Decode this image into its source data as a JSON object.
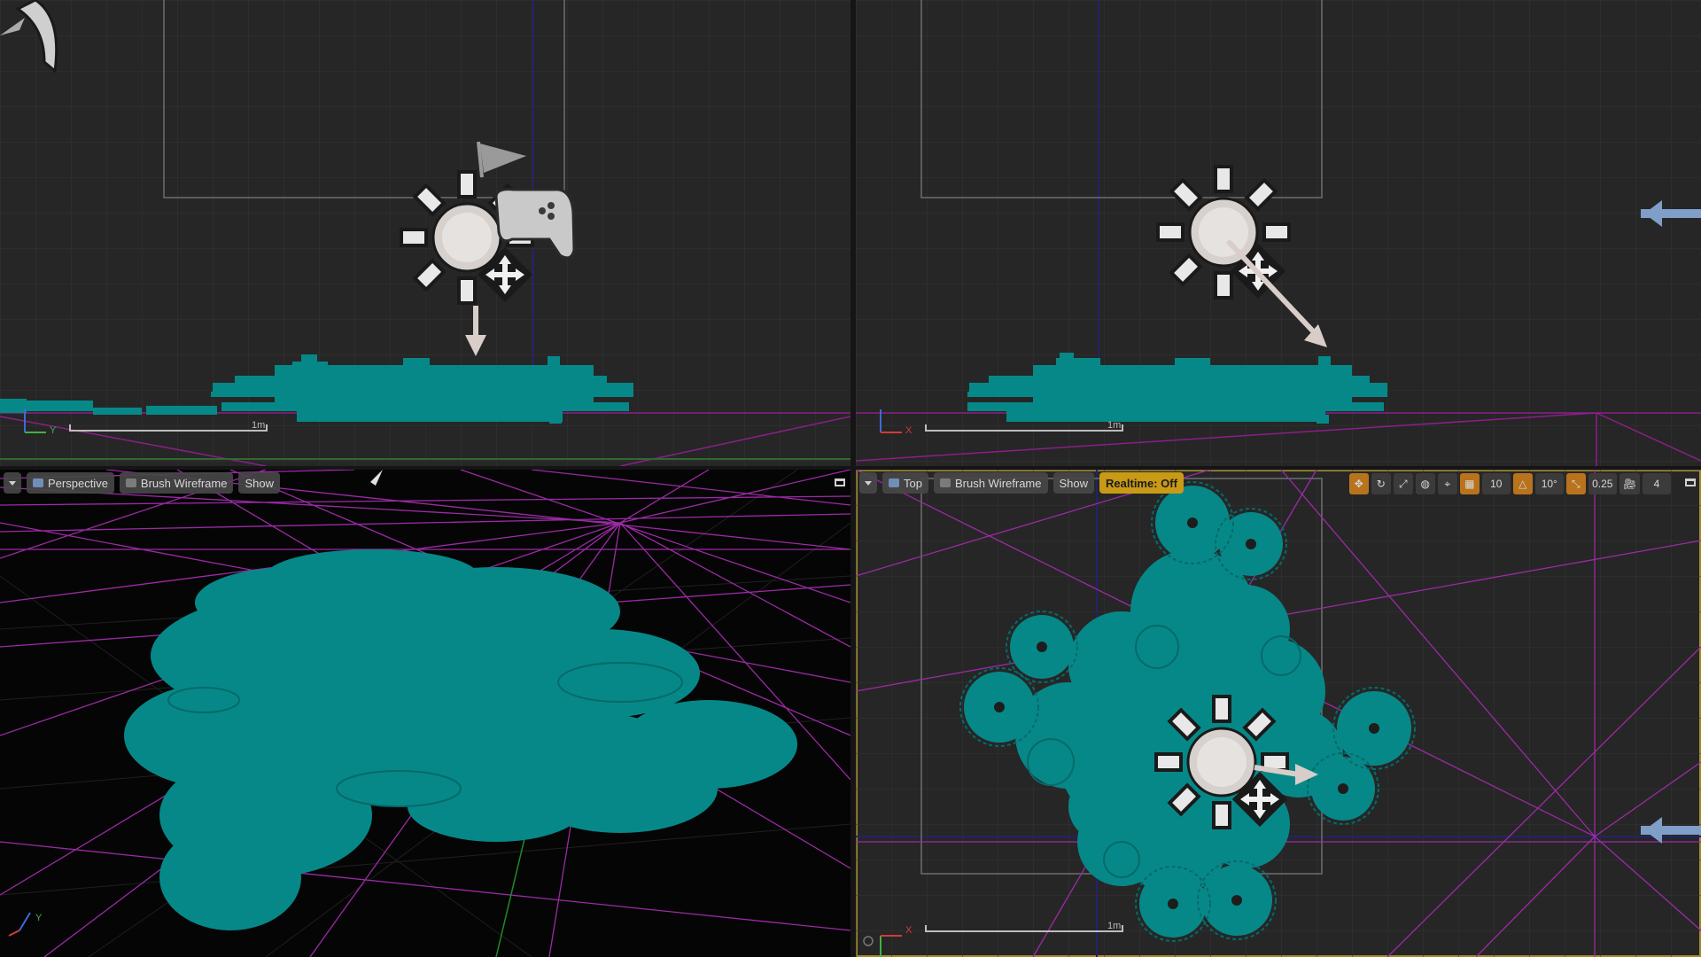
{
  "colors": {
    "accent_active_border": "#a48a2e",
    "realtime_badge": "#c99a16",
    "mesh_teal": "#078888",
    "wireframe_magenta": "#b428b4",
    "grid": "#353535",
    "background": "#262626"
  },
  "viewports": {
    "top_left": {
      "view": "side (Y axis)",
      "scale_label": "1m",
      "axis_labels": {
        "horizontal": "Y"
      }
    },
    "top_right": {
      "view": "front (X axis)",
      "scale_label": "1m",
      "axis_labels": {
        "horizontal": "X"
      }
    },
    "bottom_left": {
      "toolbar": {
        "perspective_label": "Perspective",
        "view_mode_label": "Brush Wireframe",
        "show_label": "Show"
      },
      "axis_labels": {
        "horizontal": "Y"
      }
    },
    "bottom_right": {
      "toolbar": {
        "view_label": "Top",
        "view_mode_label": "Brush Wireframe",
        "show_label": "Show",
        "realtime_label": "Realtime: Off"
      },
      "snap": {
        "grid_size": "10",
        "rotation_snap": "10°",
        "scale_snap": "0.25",
        "camera_speed": "4"
      },
      "scale_label": "1m",
      "axis_labels": {
        "horizontal": "X"
      }
    }
  }
}
